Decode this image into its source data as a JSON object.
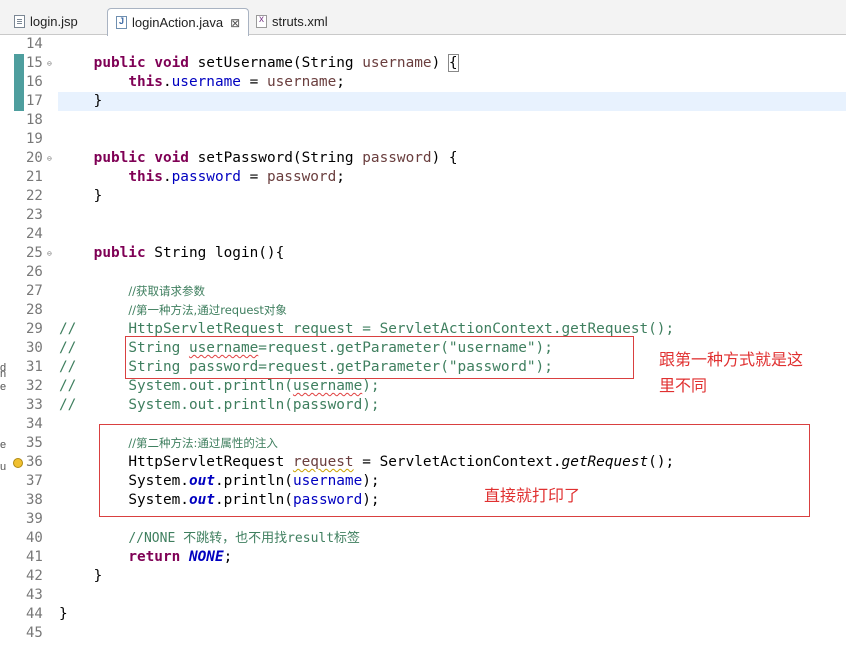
{
  "tabs": [
    {
      "label": "login.jsp",
      "icon": "jsp-file-icon"
    },
    {
      "label": "loginAction.java",
      "icon": "java-file-icon",
      "active": true,
      "close": "⊠"
    },
    {
      "label": "struts.xml",
      "icon": "xml-file-icon"
    }
  ],
  "left_ruler": {
    "fragments": [
      "n",
      "d",
      "e",
      "e",
      "u"
    ]
  },
  "lines": [
    {
      "n": "14"
    },
    {
      "n": "15"
    },
    {
      "n": "16"
    },
    {
      "n": "17"
    },
    {
      "n": "18"
    },
    {
      "n": "19"
    },
    {
      "n": "20"
    },
    {
      "n": "21"
    },
    {
      "n": "22"
    },
    {
      "n": "23"
    },
    {
      "n": "24"
    },
    {
      "n": "25"
    },
    {
      "n": "26"
    },
    {
      "n": "27"
    },
    {
      "n": "28"
    },
    {
      "n": "29"
    },
    {
      "n": "30"
    },
    {
      "n": "31"
    },
    {
      "n": "32"
    },
    {
      "n": "33"
    },
    {
      "n": "34"
    },
    {
      "n": "35"
    },
    {
      "n": "36"
    },
    {
      "n": "37"
    },
    {
      "n": "38"
    },
    {
      "n": "39"
    },
    {
      "n": "40"
    },
    {
      "n": "41"
    },
    {
      "n": "42"
    },
    {
      "n": "43"
    },
    {
      "n": "44"
    },
    {
      "n": "45"
    }
  ],
  "fold_glyph": "⊖",
  "code": {
    "l15": {
      "kw1": "public",
      "kw2": "void",
      "name": " setUsername(String ",
      "param": "username",
      "tail": ") ",
      "brace": "{"
    },
    "l16": {
      "kw": "this",
      "dot": ".",
      "field": "username",
      "eq": " = ",
      "param": "username",
      "semi": ";"
    },
    "l17": {
      "brace": "}"
    },
    "l20": {
      "kw1": "public",
      "kw2": "void",
      "name": " setPassword(String ",
      "param": "password",
      "tail": ") {"
    },
    "l21": {
      "kw": "this",
      "dot": ".",
      "field": "password",
      "eq": " = ",
      "param": "password",
      "semi": ";"
    },
    "l22": {
      "brace": "}"
    },
    "l25": {
      "kw1": "public",
      "rest": " String login(){"
    },
    "l27": {
      "comment": "//获取请求参数"
    },
    "l28": {
      "comment": "//第一种方法,通过request对象"
    },
    "l29": {
      "prefix": "//",
      "comment": "HttpServletRequest request = ServletActionContext.getRequest();"
    },
    "l30": {
      "prefix": "//",
      "p1": "String ",
      "sq": "username",
      "p2": "=request.getParameter(",
      "str": "\"username\"",
      "p3": ");"
    },
    "l31": {
      "prefix": "//",
      "p1": "String password=request.getParameter(",
      "str": "\"password\"",
      "p3": ");"
    },
    "l32": {
      "prefix": "//",
      "p1": "System.out.println(",
      "sq": "username",
      "p3": ");"
    },
    "l33": {
      "prefix": "//",
      "p1": "System.out.println(password);"
    },
    "l35": {
      "comment": "//第二种方法:通过属性的注入"
    },
    "l36": {
      "p1": "HttpServletRequest ",
      "sq": "request",
      "p2": " = ServletActionContext.",
      "m": "getRequest",
      "p3": "();"
    },
    "l37": {
      "p1": "System.",
      "st": "out",
      "p2": ".println(",
      "field": "username",
      "p3": ");"
    },
    "l38": {
      "p1": "System.",
      "st": "out",
      "p2": ".println(",
      "field": "password",
      "p3": ");"
    },
    "l40": {
      "comment": "//NONE 不跳转，也不用找result标签"
    },
    "l41": {
      "kw": "return",
      "sp": " ",
      "st": "NONE",
      "semi": ";"
    },
    "l42": {
      "brace": "}"
    },
    "l44": {
      "brace": "}"
    }
  },
  "annotations": {
    "note1_line1": "跟第一种方式就是这",
    "note1_line2": "里不同",
    "note2": "直接就打印了"
  },
  "colors": {
    "keyword": "#7f0055",
    "field": "#0000c0",
    "comment": "#3f7f5f",
    "string": "#2a00ff",
    "annotation": "#e03030"
  }
}
